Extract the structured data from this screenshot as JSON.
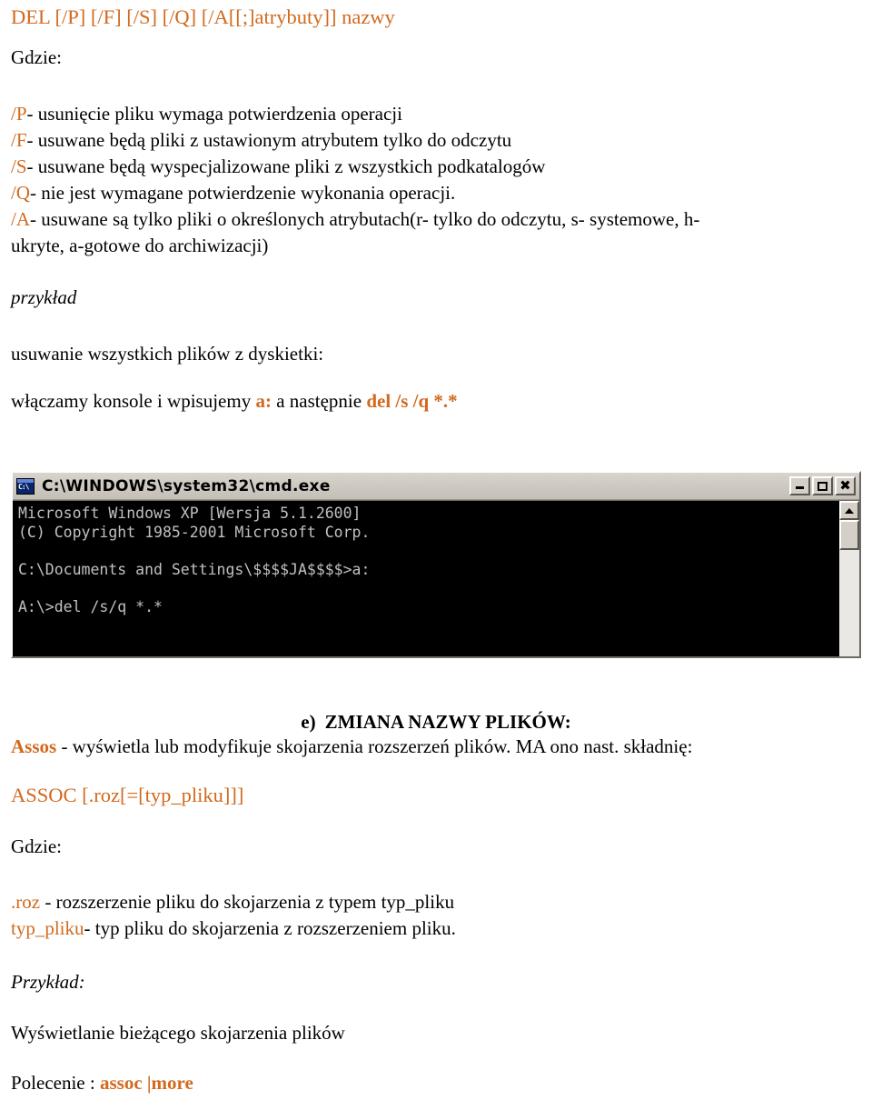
{
  "document": {
    "language": "pl",
    "accent_color": "#d2691e",
    "text_color": "#000000",
    "background_color": "#ffffff"
  },
  "del_section": {
    "syntax": "DEL [/P] [/F] [/S] [/Q] [/A[[;]atrybuty]] nazwy",
    "where_label": "Gdzie:",
    "switches": [
      {
        "flag": "/P",
        "desc": "- usunięcie pliku wymaga potwierdzenia operacji"
      },
      {
        "flag": "/F",
        "desc": "- usuwane będą pliki z ustawionym atrybutem tylko do odczytu"
      },
      {
        "flag": "/S",
        "desc": "- usuwane będą wyspecjalizowane pliki z wszystkich podkatalogów"
      },
      {
        "flag": "/Q",
        "desc": "- nie jest wymagane potwierdzenie wykonania operacji."
      },
      {
        "flag": "/A",
        "desc": "- usuwane są tylko pliki o określonych atrybutach(r- tylko do odczytu, s- systemowe, h-"
      }
    ],
    "switch_a_continuation": "ukryte, a-gotowe do archiwizacji)",
    "example_label": "przykład",
    "example_intro": "usuwanie wszystkich plików z dyskietki:",
    "example_step_prefix": "włączamy konsole i wpisujemy ",
    "example_cmd_1": "a:",
    "example_step_mid": " a następnie ",
    "example_cmd_2": "del /s /q *.*"
  },
  "console": {
    "icon": "cmd-icon",
    "icon_glyph": "C:\\",
    "title": "C:\\WINDOWS\\system32\\cmd.exe",
    "buttons": {
      "minimize": "minimize-button",
      "maximize": "maximize-button",
      "close": "close-button"
    },
    "scrollbar": {
      "up_arrow": "scroll-up-button"
    },
    "screen_lines": [
      "Microsoft Windows XP [Wersja 5.1.2600]",
      "(C) Copyright 1985-2001 Microsoft Corp.",
      "",
      "C:\\Documents and Settings\\$$$$JA$$$$>a:",
      "",
      "A:\\>del /s/q *.*"
    ],
    "screen_text": "Microsoft Windows XP [Wersja 5.1.2600]\n(C) Copyright 1985-2001 Microsoft Corp.\n\nC:\\Documents and Settings\\$$$$JA$$$$>a:\n\nA:\\>del /s/q *.*"
  },
  "assoc_section": {
    "heading_marker": "e)",
    "heading_text": "ZMIANA NAZWY PLIKÓW:",
    "command_name": "Assos",
    "command_desc": " -  wyświetla lub modyfikuje skojarzenia rozszerzeń plików. MA ono nast. składnię:",
    "syntax": "ASSOC [.roz[=[typ_pliku]]]",
    "where_label": "Gdzie:",
    "params": [
      {
        "name": ".roz",
        "desc": " - rozszerzenie pliku do skojarzenia z typem typ_pliku"
      },
      {
        "name": "typ_pliku",
        "desc": "- typ pliku do skojarzenia z rozszerzeniem pliku."
      }
    ],
    "example_label": "Przykład:",
    "example_desc": "Wyświetlanie bieżącego skojarzenia plików",
    "command_label": "Polecenie : ",
    "command_value": "assoc |more"
  }
}
